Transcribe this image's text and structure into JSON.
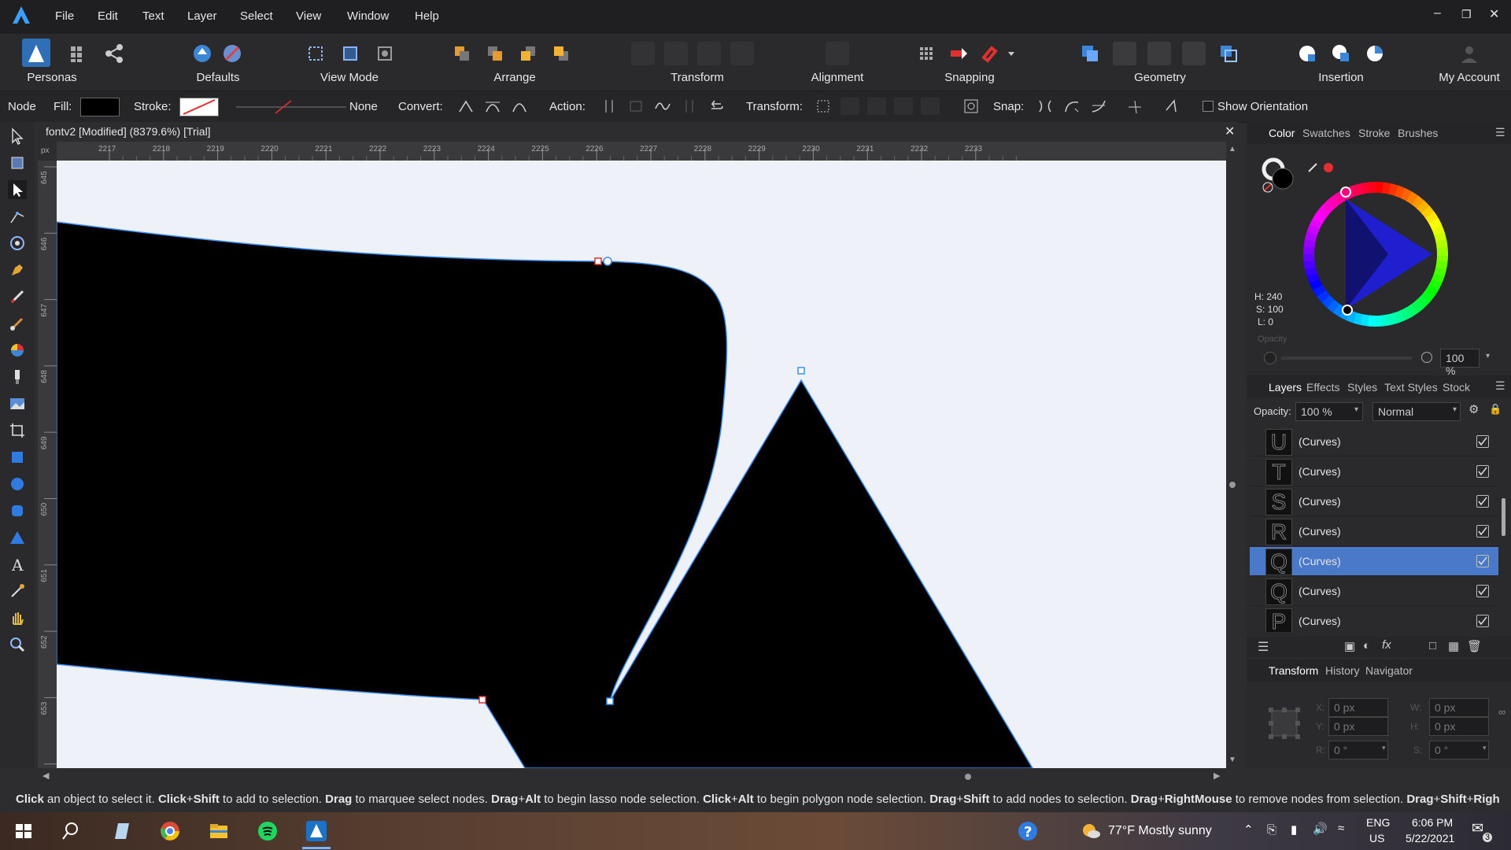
{
  "menubar": {
    "items": [
      "File",
      "Edit",
      "Text",
      "Layer",
      "Select",
      "View",
      "Window",
      "Help"
    ]
  },
  "toolbar": {
    "groups": [
      "Personas",
      "Defaults",
      "View Mode",
      "Arrange",
      "Transform",
      "Alignment",
      "Snapping",
      "Geometry",
      "Insertion",
      "My Account"
    ]
  },
  "context": {
    "mode": "Node",
    "fill_label": "Fill:",
    "stroke_label": "Stroke:",
    "stroke_none": "None",
    "convert_label": "Convert:",
    "action_label": "Action:",
    "transform_label": "Transform:",
    "snap_label": "Snap:",
    "show_orientation": "Show Orientation"
  },
  "document": {
    "tab_title": "fontv2 [Modified] (8379.6%) [Trial]",
    "ruler_unit": "px",
    "ruler_top": [
      "2217",
      "2218",
      "2219",
      "2220",
      "2221",
      "2222",
      "2223",
      "2224",
      "2225",
      "2226",
      "2227",
      "2228",
      "2229",
      "2230",
      "2231",
      "2232",
      "2233"
    ],
    "ruler_left": [
      "645",
      "646",
      "647",
      "648",
      "649",
      "650",
      "651",
      "652",
      "653",
      "654"
    ]
  },
  "color_panel": {
    "tabs": [
      "Color",
      "Swatches",
      "Stroke",
      "Brushes"
    ],
    "h": "H: 240",
    "s": "S: 100",
    "l": "L: 0",
    "opacity_label": "Opacity",
    "opacity_value": "100 %"
  },
  "layers_panel": {
    "tabs": [
      "Layers",
      "Effects",
      "Styles",
      "Text Styles",
      "Stock"
    ],
    "opacity_label": "Opacity:",
    "opacity_value": "100 %",
    "blend_mode": "Normal",
    "rows": [
      {
        "glyph": "U",
        "name": "(Curves)"
      },
      {
        "glyph": "T",
        "name": "(Curves)"
      },
      {
        "glyph": "S",
        "name": "(Curves)"
      },
      {
        "glyph": "R",
        "name": "(Curves)"
      },
      {
        "glyph": "Q",
        "name": "(Curves)"
      },
      {
        "glyph": "Q",
        "name": "(Curves)"
      },
      {
        "glyph": "P",
        "name": "(Curves)"
      }
    ]
  },
  "transform_panel": {
    "tabs": [
      "Transform",
      "History",
      "Navigator"
    ],
    "x_label": "X:",
    "x": "0 px",
    "y_label": "Y:",
    "y": "0 px",
    "w_label": "W:",
    "w": "0 px",
    "h_label": "H:",
    "h": "0 px",
    "r_label": "R:",
    "r": "0 °",
    "s_label": "S:",
    "s": "0 °"
  },
  "status": {
    "parts": [
      {
        "b": "Click",
        "t": " an object to select it. "
      },
      {
        "b": "Click",
        "t": "+"
      },
      {
        "b": "Shift",
        "t": " to add to selection. "
      },
      {
        "b": "Drag",
        "t": " to marquee select nodes. "
      },
      {
        "b": "Drag",
        "t": "+"
      },
      {
        "b": "Alt",
        "t": " to begin lasso node selection. "
      },
      {
        "b": "Click",
        "t": "+"
      },
      {
        "b": "Alt",
        "t": " to begin polygon node selection. "
      },
      {
        "b": "Drag",
        "t": "+"
      },
      {
        "b": "Shift",
        "t": " to add nodes to selection. "
      },
      {
        "b": "Drag",
        "t": "+"
      },
      {
        "b": "RightMouse",
        "t": " to remove nodes from selection. "
      },
      {
        "b": "Drag",
        "t": "+"
      },
      {
        "b": "Shift",
        "t": "+"
      },
      {
        "b": "Righ",
        "t": ""
      }
    ]
  },
  "taskbar": {
    "weather": "77°F  Mostly sunny",
    "lang1": "ENG",
    "lang2": "US",
    "time": "6:06 PM",
    "date": "5/22/2021",
    "notif_count": "3"
  },
  "colors": {
    "accent": "#4a79c9",
    "selection_stroke": "#3d8ef0",
    "node_red": "#e03030"
  }
}
